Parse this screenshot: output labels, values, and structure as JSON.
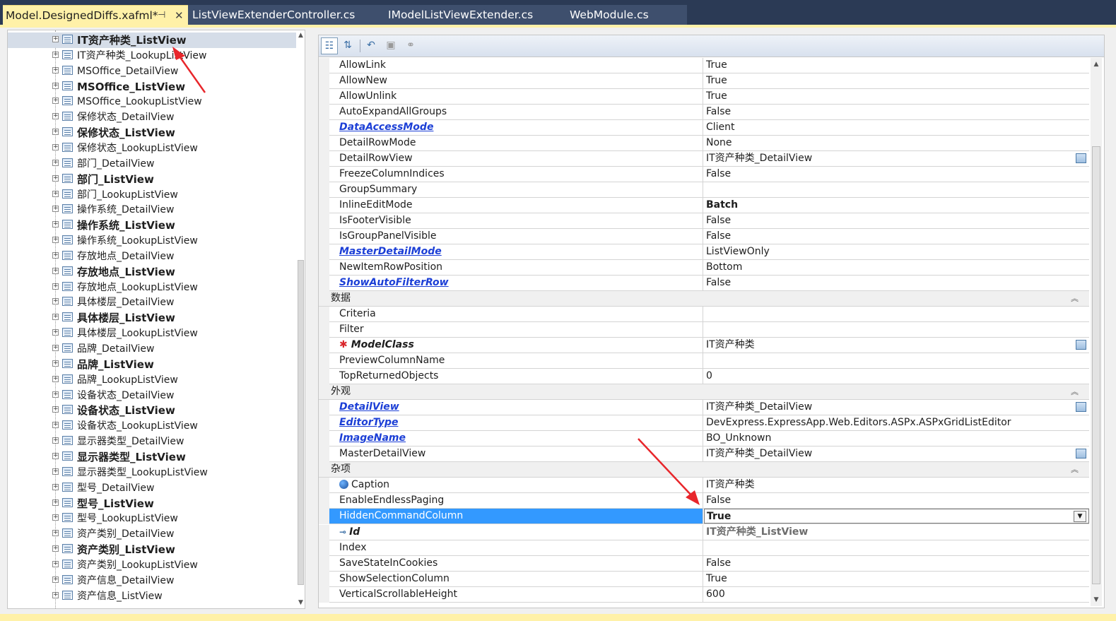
{
  "tabs": [
    {
      "label": "Model.DesignedDiffs.xafml*",
      "active": true
    },
    {
      "label": "ListViewExtenderController.cs",
      "active": false
    },
    {
      "label": "IModelListViewExtender.cs",
      "active": false
    },
    {
      "label": "WebModule.cs",
      "active": false
    }
  ],
  "tab_pin_icon": "pin-icon",
  "tab_close_icon": "close-icon",
  "tree": {
    "items": [
      {
        "label": "IT资产种类_ListView",
        "bold": true,
        "selected": true
      },
      {
        "label": "IT资产种类_LookupListView",
        "bold": false
      },
      {
        "label": "MSOffice_DetailView",
        "bold": false
      },
      {
        "label": "MSOffice_ListView",
        "bold": true
      },
      {
        "label": "MSOffice_LookupListView",
        "bold": false
      },
      {
        "label": "保修状态_DetailView",
        "bold": false
      },
      {
        "label": "保修状态_ListView",
        "bold": true
      },
      {
        "label": "保修状态_LookupListView",
        "bold": false
      },
      {
        "label": "部门_DetailView",
        "bold": false
      },
      {
        "label": "部门_ListView",
        "bold": true
      },
      {
        "label": "部门_LookupListView",
        "bold": false
      },
      {
        "label": "操作系统_DetailView",
        "bold": false
      },
      {
        "label": "操作系统_ListView",
        "bold": true
      },
      {
        "label": "操作系统_LookupListView",
        "bold": false
      },
      {
        "label": "存放地点_DetailView",
        "bold": false
      },
      {
        "label": "存放地点_ListView",
        "bold": true
      },
      {
        "label": "存放地点_LookupListView",
        "bold": false
      },
      {
        "label": "具体楼层_DetailView",
        "bold": false
      },
      {
        "label": "具体楼层_ListView",
        "bold": true
      },
      {
        "label": "具体楼层_LookupListView",
        "bold": false
      },
      {
        "label": "品牌_DetailView",
        "bold": false
      },
      {
        "label": "品牌_ListView",
        "bold": true
      },
      {
        "label": "品牌_LookupListView",
        "bold": false
      },
      {
        "label": "设备状态_DetailView",
        "bold": false
      },
      {
        "label": "设备状态_ListView",
        "bold": true
      },
      {
        "label": "设备状态_LookupListView",
        "bold": false
      },
      {
        "label": "显示器类型_DetailView",
        "bold": false
      },
      {
        "label": "显示器类型_ListView",
        "bold": true
      },
      {
        "label": "显示器类型_LookupListView",
        "bold": false
      },
      {
        "label": "型号_DetailView",
        "bold": false
      },
      {
        "label": "型号_ListView",
        "bold": true
      },
      {
        "label": "型号_LookupListView",
        "bold": false
      },
      {
        "label": "资产类别_DetailView",
        "bold": false
      },
      {
        "label": "资产类别_ListView",
        "bold": true
      },
      {
        "label": "资产类别_LookupListView",
        "bold": false
      },
      {
        "label": "资产信息_DetailView",
        "bold": false
      },
      {
        "label": "资产信息_ListView",
        "bold": false
      }
    ]
  },
  "toolbar": {
    "buttons": [
      "categorized-icon",
      "alphabetical-icon",
      "undo-icon",
      "property-pages-icon",
      "link-icon"
    ]
  },
  "property_grid": {
    "rows": [
      {
        "kind": "prop",
        "name": "AllowLink",
        "value": "True"
      },
      {
        "kind": "prop",
        "name": "AllowNew",
        "value": "True"
      },
      {
        "kind": "prop",
        "name": "AllowUnlink",
        "value": "True"
      },
      {
        "kind": "prop",
        "name": "AutoExpandAllGroups",
        "value": "False"
      },
      {
        "kind": "prop",
        "name": "DataAccessMode",
        "value": "Client",
        "style": "link"
      },
      {
        "kind": "prop",
        "name": "DetailRowMode",
        "value": "None"
      },
      {
        "kind": "prop",
        "name": "DetailRowView",
        "value": "IT资产种类_DetailView",
        "editor": true
      },
      {
        "kind": "prop",
        "name": "FreezeColumnIndices",
        "value": "False"
      },
      {
        "kind": "prop",
        "name": "GroupSummary",
        "value": ""
      },
      {
        "kind": "prop",
        "name": "InlineEditMode",
        "value": "Batch",
        "valueStyle": "bold"
      },
      {
        "kind": "prop",
        "name": "IsFooterVisible",
        "value": "False"
      },
      {
        "kind": "prop",
        "name": "IsGroupPanelVisible",
        "value": "False"
      },
      {
        "kind": "prop",
        "name": "MasterDetailMode",
        "value": "ListViewOnly",
        "style": "link"
      },
      {
        "kind": "prop",
        "name": "NewItemRowPosition",
        "value": "Bottom"
      },
      {
        "kind": "prop",
        "name": "ShowAutoFilterRow",
        "value": "False",
        "style": "link"
      },
      {
        "kind": "category",
        "name": "数据"
      },
      {
        "kind": "prop",
        "name": "Criteria",
        "value": ""
      },
      {
        "kind": "prop",
        "name": "Filter",
        "value": ""
      },
      {
        "kind": "prop",
        "name": "ModelClass",
        "value": "IT资产种类",
        "style": "required",
        "editor": true
      },
      {
        "kind": "prop",
        "name": "PreviewColumnName",
        "value": ""
      },
      {
        "kind": "prop",
        "name": "TopReturnedObjects",
        "value": "0"
      },
      {
        "kind": "category",
        "name": "外观"
      },
      {
        "kind": "prop",
        "name": "DetailView",
        "value": "IT资产种类_DetailView",
        "style": "link",
        "editor": true
      },
      {
        "kind": "prop",
        "name": "EditorType",
        "value": "DevExpress.ExpressApp.Web.Editors.ASPx.ASPxGridListEditor",
        "style": "link"
      },
      {
        "kind": "prop",
        "name": "ImageName",
        "value": "BO_Unknown",
        "style": "link"
      },
      {
        "kind": "prop",
        "name": "MasterDetailView",
        "value": "IT资产种类_DetailView",
        "editor": true
      },
      {
        "kind": "category",
        "name": "杂项"
      },
      {
        "kind": "prop",
        "name": "Caption",
        "value": "IT资产种类",
        "style": "globe"
      },
      {
        "kind": "prop",
        "name": "EnableEndlessPaging",
        "value": "False"
      },
      {
        "kind": "prop",
        "name": "HiddenCommandColumn",
        "value": "True",
        "selected": true,
        "dropdown": true
      },
      {
        "kind": "prop",
        "name": "Id",
        "value": "IT资产种类_ListView",
        "style": "key",
        "valueStyle": "grey"
      },
      {
        "kind": "prop",
        "name": "Index",
        "value": ""
      },
      {
        "kind": "prop",
        "name": "SaveStateInCookies",
        "value": "False"
      },
      {
        "kind": "prop",
        "name": "ShowSelectionColumn",
        "value": "True"
      },
      {
        "kind": "prop",
        "name": "VerticalScrollableHeight",
        "value": "600"
      }
    ]
  },
  "colors": {
    "tab_bar": "#2b3a55",
    "active_tab": "#fff1a8",
    "selection": "#3399ff",
    "link": "#1c3fd6",
    "annotation_arrow": "#e8262b"
  }
}
